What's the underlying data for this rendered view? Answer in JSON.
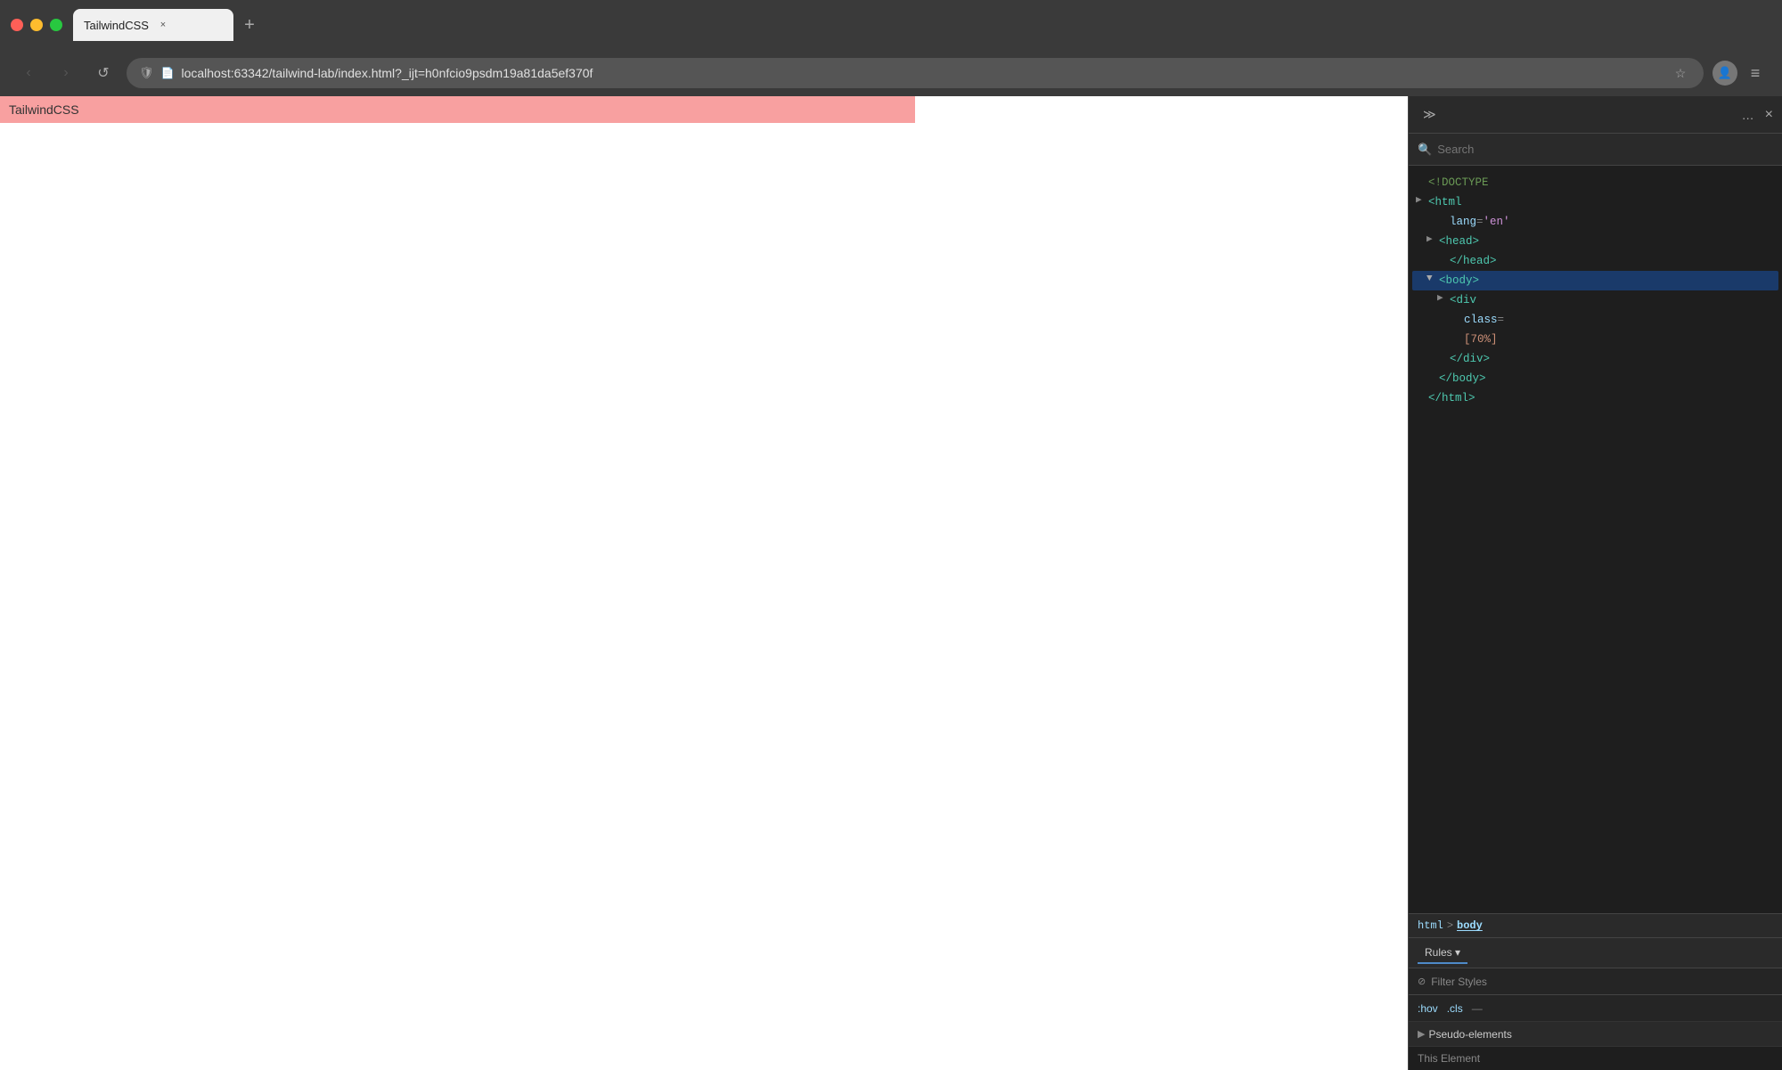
{
  "browser": {
    "traffic_lights": {
      "red": "red",
      "yellow": "yellow",
      "green": "green"
    },
    "tab": {
      "title": "TailwindCSS",
      "close_icon": "×"
    },
    "new_tab_icon": "+",
    "nav": {
      "back_icon": "‹",
      "forward_icon": "›",
      "reload_icon": "↺",
      "url": "localhost:63342/tailwind-lab/index.html?_ijt=h0nfcio9psdm19a81da5ef370f",
      "security_icon": "🛡",
      "bookmark_icon": "☆",
      "profile_icon": "👤",
      "menu_icon": "≡"
    },
    "page": {
      "title": "TailwindCSS",
      "banner_color": "#f8a0a0"
    }
  },
  "devtools": {
    "toolbar": {
      "expand_icon": "≫",
      "more_icon": "…",
      "close_icon": "×"
    },
    "search": {
      "placeholder": "Search",
      "icon": "🔍"
    },
    "dom": {
      "doctype": "<!DOCTYPE",
      "lines": [
        {
          "id": "doctype",
          "indent": 0,
          "arrow": "empty",
          "content": "<!DOCTYPE"
        },
        {
          "id": "html-open",
          "indent": 0,
          "arrow": "collapsed",
          "content": "<html"
        },
        {
          "id": "html-lang",
          "indent": 1,
          "arrow": "empty",
          "content": "lang=\"en\""
        },
        {
          "id": "head-open",
          "indent": 1,
          "arrow": "collapsed",
          "content": "<head>"
        },
        {
          "id": "head-close",
          "indent": 1,
          "arrow": "empty",
          "content": "</head>"
        },
        {
          "id": "body-open",
          "indent": 1,
          "arrow": "expanded",
          "selected": true,
          "content": "<body>"
        },
        {
          "id": "div-open",
          "indent": 2,
          "arrow": "collapsed",
          "content": "<div"
        },
        {
          "id": "div-class",
          "indent": 3,
          "arrow": "empty",
          "content": "class="
        },
        {
          "id": "div-70",
          "indent": 3,
          "arrow": "empty",
          "content": "[70%]"
        },
        {
          "id": "div-close",
          "indent": 2,
          "arrow": "empty",
          "content": "</div>"
        },
        {
          "id": "body-close",
          "indent": 1,
          "arrow": "empty",
          "content": "</body>"
        },
        {
          "id": "html-close",
          "indent": 0,
          "arrow": "empty",
          "content": "</html>"
        }
      ]
    },
    "breadcrumb": {
      "html": "html",
      "sep": ">",
      "body": "body"
    },
    "styles": {
      "rules_label": "Rules",
      "chevron": "▾"
    },
    "filter": {
      "icon": "⊘",
      "label": "Filter Styles"
    },
    "pseudo": {
      "hov": ":hov",
      "cls": ".cls",
      "dash": "—"
    },
    "pseudo_elements": {
      "arrow": "▶",
      "label": "Pseudo-elements"
    },
    "this_element": {
      "label": "This Element"
    }
  }
}
